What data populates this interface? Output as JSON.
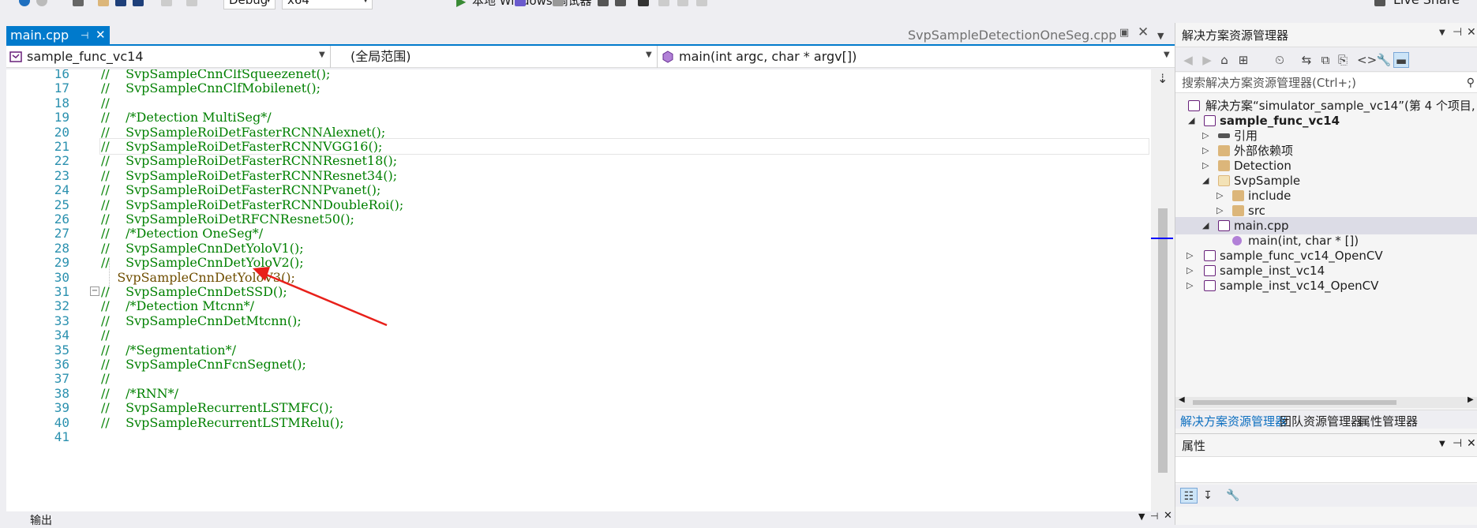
{
  "toolbar": {
    "config_value": "Debug",
    "platform_value": "x64",
    "run_label": "本地 Windows 调试器",
    "live_share_label": "Live Share"
  },
  "tabs": {
    "active": "main.cpp",
    "other": "SvpSampleDetectionOneSeg.cpp"
  },
  "nav": {
    "project": "sample_func_vc14",
    "scope": "(全局范围)",
    "member": "main(int argc, char * argv[])"
  },
  "editor": {
    "lines": [
      {
        "num": "16",
        "text": "//    SvpSampleCnnClfSqueezenet();"
      },
      {
        "num": "17",
        "text": "//    SvpSampleCnnClfMobilenet();"
      },
      {
        "num": "18",
        "text": "//"
      },
      {
        "num": "19",
        "text": "//    /*Detection MultiSeg*/"
      },
      {
        "num": "20",
        "text": "//    SvpSampleRoiDetFasterRCNNAlexnet();"
      },
      {
        "num": "21",
        "text": "//    SvpSampleRoiDetFasterRCNNVGG16();"
      },
      {
        "num": "22",
        "text": "//    SvpSampleRoiDetFasterRCNNResnet18();"
      },
      {
        "num": "23",
        "text": "//    SvpSampleRoiDetFasterRCNNResnet34();"
      },
      {
        "num": "24",
        "text": "//    SvpSampleRoiDetFasterRCNNPvanet();"
      },
      {
        "num": "25",
        "text": "//    SvpSampleRoiDetFasterRCNNDoubleRoi();"
      },
      {
        "num": "26",
        "text": "//    SvpSampleRoiDetRFCNResnet50();"
      },
      {
        "num": "27",
        "text": "//    /*Detection OneSeg*/"
      },
      {
        "num": "28",
        "text": "//    SvpSampleCnnDetYoloV1();"
      },
      {
        "num": "29",
        "text": "//    SvpSampleCnnDetYoloV2();"
      },
      {
        "num": "30",
        "text": "    SvpSampleCnnDetYoloV3();"
      },
      {
        "num": "31",
        "text": "//    SvpSampleCnnDetSSD();"
      },
      {
        "num": "32",
        "text": "//    /*Detection Mtcnn*/"
      },
      {
        "num": "33",
        "text": "//    SvpSampleCnnDetMtcnn();"
      },
      {
        "num": "34",
        "text": "//"
      },
      {
        "num": "35",
        "text": "//    /*Segmentation*/"
      },
      {
        "num": "36",
        "text": "//    SvpSampleCnnFcnSegnet();"
      },
      {
        "num": "37",
        "text": "//"
      },
      {
        "num": "38",
        "text": "//    /*RNN*/"
      },
      {
        "num": "39",
        "text": "//    SvpSampleRecurrentLSTMFC();"
      },
      {
        "num": "40",
        "text": "//    SvpSampleRecurrentLSTMRelu();"
      },
      {
        "num": "41",
        "text": ""
      }
    ]
  },
  "output": {
    "title": "输出"
  },
  "solution_explorer": {
    "title": "解决方案资源管理器",
    "search_placeholder": "搜索解决方案资源管理器(Ctrl+;)",
    "tree": [
      {
        "label": "解决方案“simulator_sample_vc14”(第 4 个项目,",
        "icon": "solution-icon"
      },
      {
        "label": "sample_func_vc14",
        "icon": "project-icon"
      },
      {
        "label": "引用",
        "icon": "references-icon"
      },
      {
        "label": "外部依赖项",
        "icon": "external-deps-icon"
      },
      {
        "label": "Detection",
        "icon": "folder-icon"
      },
      {
        "label": "SvpSample",
        "icon": "folder-icon"
      },
      {
        "label": "include",
        "icon": "folder-icon"
      },
      {
        "label": "src",
        "icon": "folder-icon"
      },
      {
        "label": "main.cpp",
        "icon": "cpp-file-icon"
      },
      {
        "label": "main(int, char * [])",
        "icon": "function-icon"
      },
      {
        "label": "sample_func_vc14_OpenCV",
        "icon": "project-icon"
      },
      {
        "label": "sample_inst_vc14",
        "icon": "project-icon"
      },
      {
        "label": "sample_inst_vc14_OpenCV",
        "icon": "project-icon"
      }
    ],
    "bottom_tabs": [
      "解决方案资源管理器",
      "团队资源管理器",
      "属性管理器"
    ]
  },
  "properties": {
    "title": "属性"
  },
  "colors": {
    "accent": "#007acc",
    "comment": "#008000",
    "line_number": "#2b91af",
    "arrow": "#e8201a"
  }
}
